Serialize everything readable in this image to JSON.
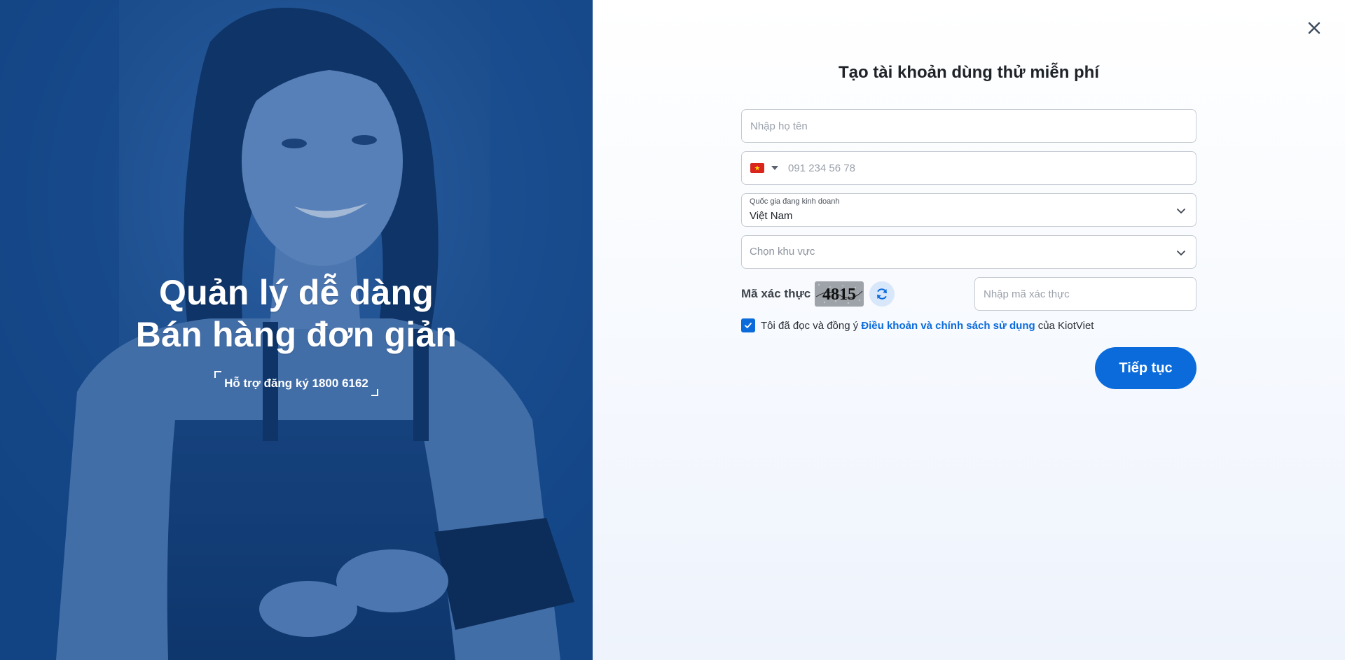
{
  "hero": {
    "headline_line1": "Quản lý dễ dàng",
    "headline_line2": "Bán hàng đơn giản",
    "support_text": "Hỗ trợ đăng ký 1800 6162"
  },
  "form": {
    "title": "Tạo tài khoản dùng thử miễn phí",
    "name_placeholder": "Nhập họ tên",
    "phone_placeholder": "091 234 56 78",
    "country_label": "Quốc gia đang kinh doanh",
    "country_value": "Việt Nam",
    "region_placeholder": "Chọn khu vực",
    "captcha_label": "Mã xác thực",
    "captcha_code": "4815",
    "captcha_placeholder": "Nhập mã xác thực",
    "terms_prefix": "Tôi đã đọc và đồng ý",
    "terms_link": "Điều khoản và chính sách sử dụng",
    "terms_suffix": "của KiotViet",
    "terms_checked": true,
    "submit_label": "Tiếp tục"
  },
  "icons": {
    "close": "close-icon",
    "flag": "vietnam-flag-icon",
    "caret": "caret-down-icon",
    "chevron": "chevron-down-icon",
    "refresh": "refresh-icon",
    "check": "check-icon"
  },
  "colors": {
    "primary": "#0b6bdb",
    "hero_bg": "#164a87",
    "flag_red": "#da251d",
    "flag_star": "#ffde00"
  }
}
